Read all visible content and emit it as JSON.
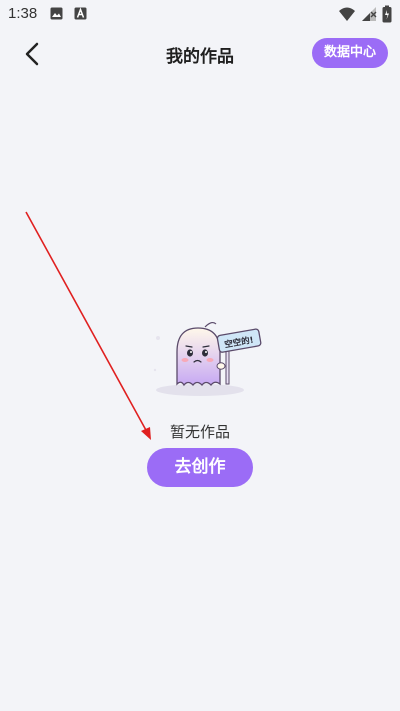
{
  "status_bar": {
    "time": "1:38",
    "icons": [
      "image-icon",
      "a-icon",
      "wifi-icon",
      "signal-icon",
      "battery-icon"
    ]
  },
  "header": {
    "title": "我的作品",
    "back_icon": "chevron-left-icon",
    "data_center_label": "数据中心"
  },
  "empty_state": {
    "illustration": "ghost-holding-sign-icon",
    "sign_text": "空空的!",
    "message": "暂无作品",
    "create_label": "去创作"
  },
  "colors": {
    "accent": "#9b6cf6",
    "background": "#f3f4f8",
    "annotation": "#e02020"
  }
}
